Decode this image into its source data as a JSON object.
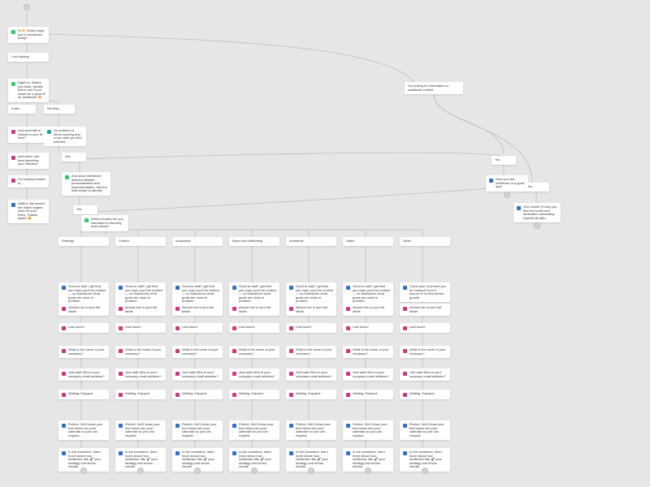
{
  "root": {
    "label": "Hi 👋 What brings you to Intellimize today?"
  },
  "left": {
    "a": "I am looking",
    "b": "Right on. Before you book, quickly test to see if you would be a good fit for Intellimize 🔥",
    "c_l": "A site",
    "c_r": "We help...",
    "d_l": "And what title is closest to your fit here?",
    "d_r": "No problem! A demo working and a use case you find relevant.",
    "e_l": "And which one best describes your industry?",
    "e_r": "Yes",
    "f_l": "I'm looking forward to...",
    "f_r": "And since Intellimize delivers website personalization and experimentation, find the best words to identify",
    "g_l": "Write in the search bar which targets work for your team. Thanks again! 😊",
    "g_r": "Yes"
  },
  "right": {
    "top": "I'm looking for information or additional content",
    "yes": "Yes",
    "no": "No",
    "yes_child": "Glad you see Intellimize is a good app!",
    "no_child": "One buckle I'll help you find the books and dedicated onboarding experts all with!"
  },
  "module_q": "Which module are you interested in learning more about?",
  "categories": [
    "Strategy",
    "Culture",
    "Acquisition",
    "Brand and Marketing",
    "Architects",
    "Sales",
    "Other"
  ],
  "row_text": {
    "r1": "Good to add! I get that you hope you'll be excited — so brainstorm what goals are most at problem.",
    "r2": "Almost info in your full stride",
    "r3": "Last touch!",
    "r4": "What is the name of your company?",
    "r5": "Just wait! Who is your company email address?",
    "r6": "Waiting. Enjoyed.",
    "r7": "Perfect. We'll show your text below into your calendar so you can request.",
    "r8": "In the meantime, learn more about how Intellimize lifts 🚀 your strategy and drives results."
  },
  "col7_r1": "Come join! I just sent you an example from a source of us that serves growth.",
  "icons": {
    "green": "message-icon",
    "magenta": "field-icon",
    "blue": "link-icon",
    "teal": "info-icon"
  }
}
